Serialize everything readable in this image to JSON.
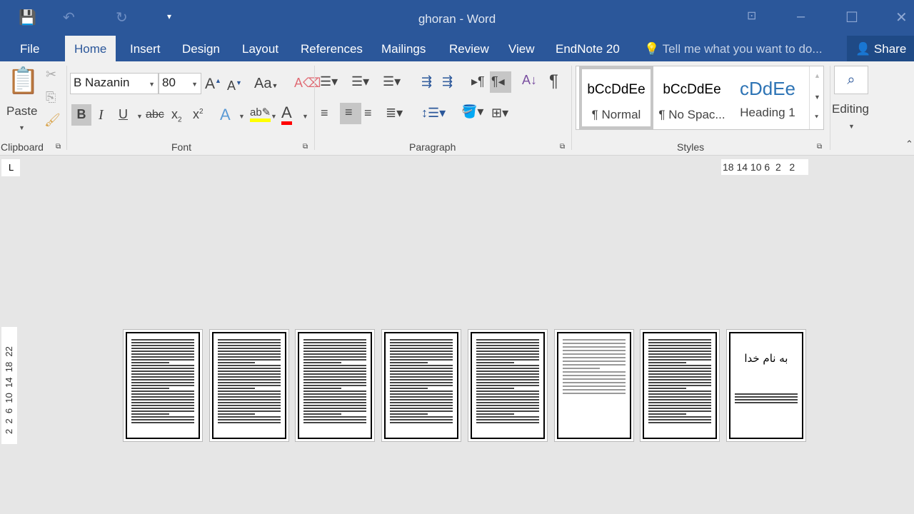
{
  "window": {
    "title": "ghoran - Word"
  },
  "tabs": [
    {
      "label": "File"
    },
    {
      "label": "Home"
    },
    {
      "label": "Insert"
    },
    {
      "label": "Design"
    },
    {
      "label": "Layout"
    },
    {
      "label": "References"
    },
    {
      "label": "Mailings"
    },
    {
      "label": "Review"
    },
    {
      "label": "View"
    },
    {
      "label": "EndNote 20"
    }
  ],
  "tell_me": {
    "placeholder": "Tell me what you want to do..."
  },
  "share": {
    "label": "Share"
  },
  "clipboard": {
    "paste": "Paste",
    "group": "Clipboard"
  },
  "font": {
    "name": "B Nazanin",
    "size": "80",
    "group": "Font",
    "change_case": "Aa"
  },
  "paragraph": {
    "group": "Paragraph"
  },
  "styles": {
    "group": "Styles",
    "items": [
      {
        "sample": "bCcDdEe",
        "name": "¶ Normal"
      },
      {
        "sample": "bCcDdEe",
        "name": "¶ No Spac..."
      },
      {
        "sample": "cDdEe",
        "name": "Heading 1"
      }
    ]
  },
  "editing": {
    "label": "Editing"
  },
  "ruler": {
    "h": "18 14 10 6  2   2",
    "v": "2  2  6  10  14  18  22"
  },
  "pages": {
    "count": 8,
    "last_page_text": "به نام خدا"
  },
  "colors": {
    "accent": "#2b579a",
    "highlight": "#ffff00",
    "font_color": "#ff0000"
  }
}
